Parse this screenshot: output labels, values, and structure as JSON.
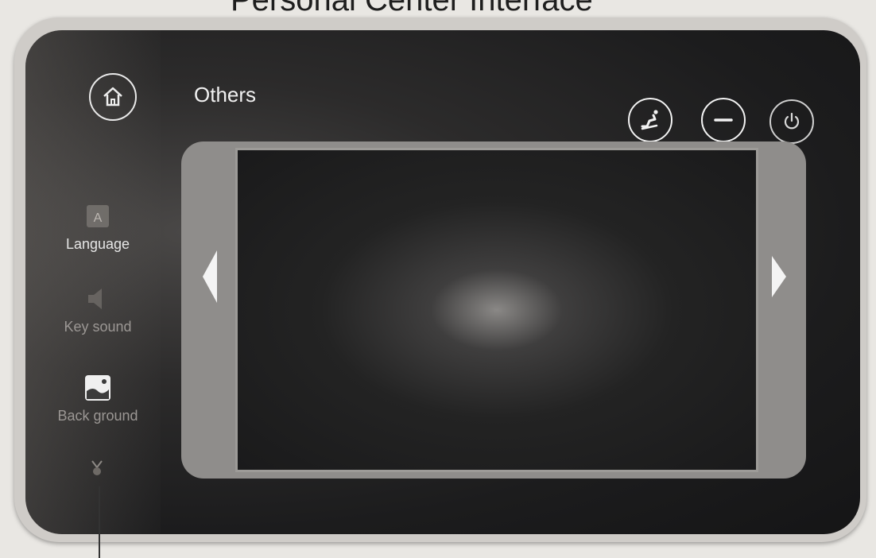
{
  "caption": "Personal Center Interface",
  "header": {
    "title": "Others"
  },
  "sidebar": {
    "items": [
      {
        "label": "Language",
        "icon": "language-icon",
        "state": "normal"
      },
      {
        "label": "Key sound",
        "icon": "speaker-icon",
        "state": "dim"
      },
      {
        "label": "Back ground",
        "icon": "background-image-icon",
        "state": "dim"
      }
    ]
  },
  "toolbar": {
    "buttons": [
      {
        "icon": "recliner-icon"
      },
      {
        "icon": "minus-icon"
      },
      {
        "icon": "power-icon"
      }
    ]
  },
  "colors": {
    "screen_bg": "#1c1c1d",
    "frame": "#8f8d8b",
    "bezel": "#cfccc8",
    "text": "#f1f1f1"
  }
}
